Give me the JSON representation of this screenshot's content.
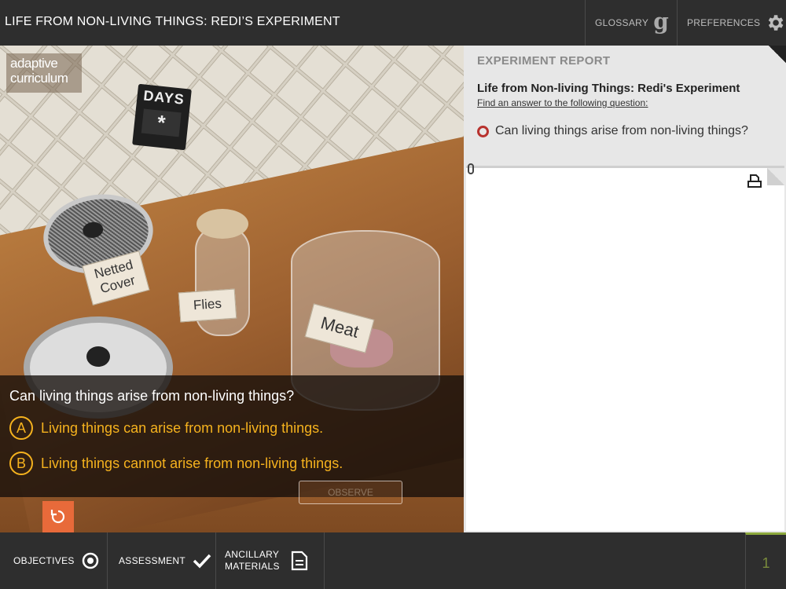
{
  "header": {
    "title": "LIFE FROM NON-LIVING THINGS: REDI’S EXPERIMENT",
    "glossary_label": "GLOSSARY",
    "glossary_icon": "g",
    "preferences_label": "PREFERENCES"
  },
  "scene": {
    "logo_line1": "adaptive",
    "logo_line2": "curriculum",
    "days_sign": "DAYS",
    "days_value": "*",
    "labels": {
      "netted_line1": "Netted",
      "netted_line2": "Cover",
      "flies": "Flies",
      "meat": "Meat"
    },
    "observe_label": "OBSERVE"
  },
  "question": {
    "text": "Can living things arise from non-living things?",
    "options": [
      {
        "letter": "A",
        "text": "Living things can arise from non-living things."
      },
      {
        "letter": "B",
        "text": "Living things cannot arise from non-living things."
      }
    ]
  },
  "report": {
    "title": "EXPERIMENT REPORT",
    "subtitle": "Life from Non-living Things: Redi's Experiment",
    "instruction": "Find an answer to the following question:",
    "question": "Can living things arise from non-living things?"
  },
  "footer": {
    "objectives_label": "OBJECTIVES",
    "assessment_label": "ASSESSMENT",
    "ancillary_line1": "ANCILLARY",
    "ancillary_line2": "MATERIALS",
    "page_number": "1"
  },
  "colors": {
    "accent": "#f5b21e",
    "reset": "#e86a3a",
    "radio": "#b8322e",
    "page_indicator": "#8ca83c"
  }
}
